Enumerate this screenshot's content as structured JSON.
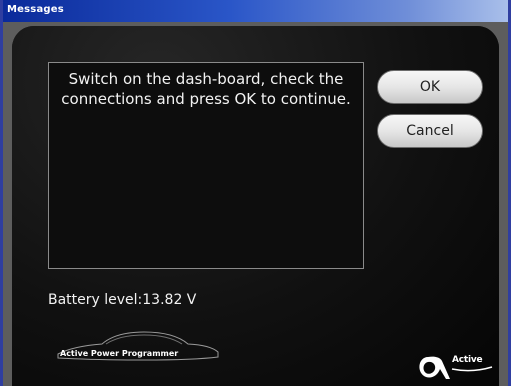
{
  "window": {
    "title": "Messages"
  },
  "message": {
    "text": "Switch on the dash-board, check the connections and press OK to continue."
  },
  "buttons": {
    "ok_label": "OK",
    "cancel_label": "Cancel"
  },
  "status": {
    "battery_text": "Battery level:13.82 V"
  },
  "branding": {
    "product_name": "Active Power Programmer",
    "brand_name": "Active"
  },
  "colors": {
    "titlebar_left": "#0a2a9a",
    "titlebar_right": "#a9bfea",
    "panel_background": "#0a0a0a",
    "text": "#f2f2f2"
  }
}
